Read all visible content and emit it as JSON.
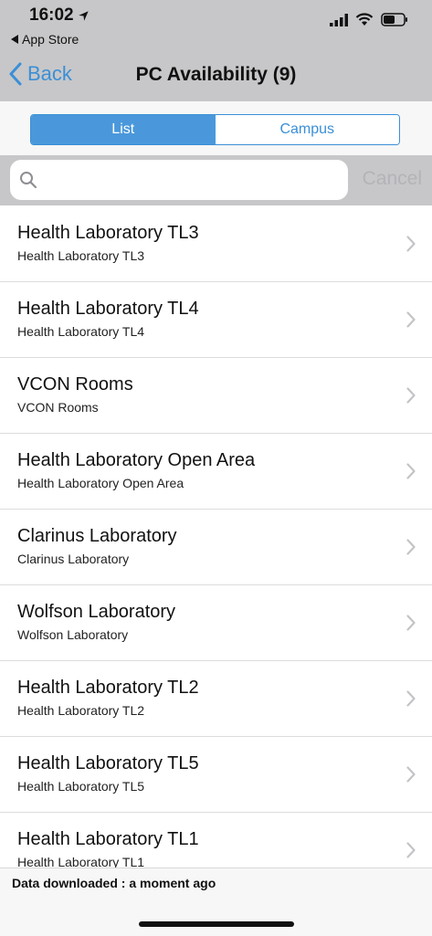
{
  "status": {
    "time": "16:02",
    "back_app": "App Store"
  },
  "nav": {
    "back_label": "Back",
    "title": "PC Availability (9)"
  },
  "segment": {
    "list_label": "List",
    "campus_label": "Campus"
  },
  "search": {
    "placeholder": "",
    "cancel_label": "Cancel"
  },
  "items": [
    {
      "title": "Health Laboratory TL3",
      "subtitle": "Health Laboratory TL3"
    },
    {
      "title": "Health Laboratory TL4",
      "subtitle": "Health Laboratory TL4"
    },
    {
      "title": "VCON Rooms",
      "subtitle": "VCON Rooms"
    },
    {
      "title": "Health Laboratory Open Area",
      "subtitle": "Health Laboratory Open Area"
    },
    {
      "title": "Clarinus Laboratory",
      "subtitle": "Clarinus Laboratory"
    },
    {
      "title": "Wolfson Laboratory",
      "subtitle": "Wolfson Laboratory"
    },
    {
      "title": "Health Laboratory TL2",
      "subtitle": "Health Laboratory TL2"
    },
    {
      "title": "Health Laboratory TL5",
      "subtitle": "Health Laboratory TL5"
    },
    {
      "title": "Health Laboratory TL1",
      "subtitle": "Health Laboratory TL1"
    }
  ],
  "footer": {
    "text": "Data downloaded : a moment ago"
  },
  "colors": {
    "accent": "#3b8fd6",
    "bar": "#c7c7c9"
  }
}
